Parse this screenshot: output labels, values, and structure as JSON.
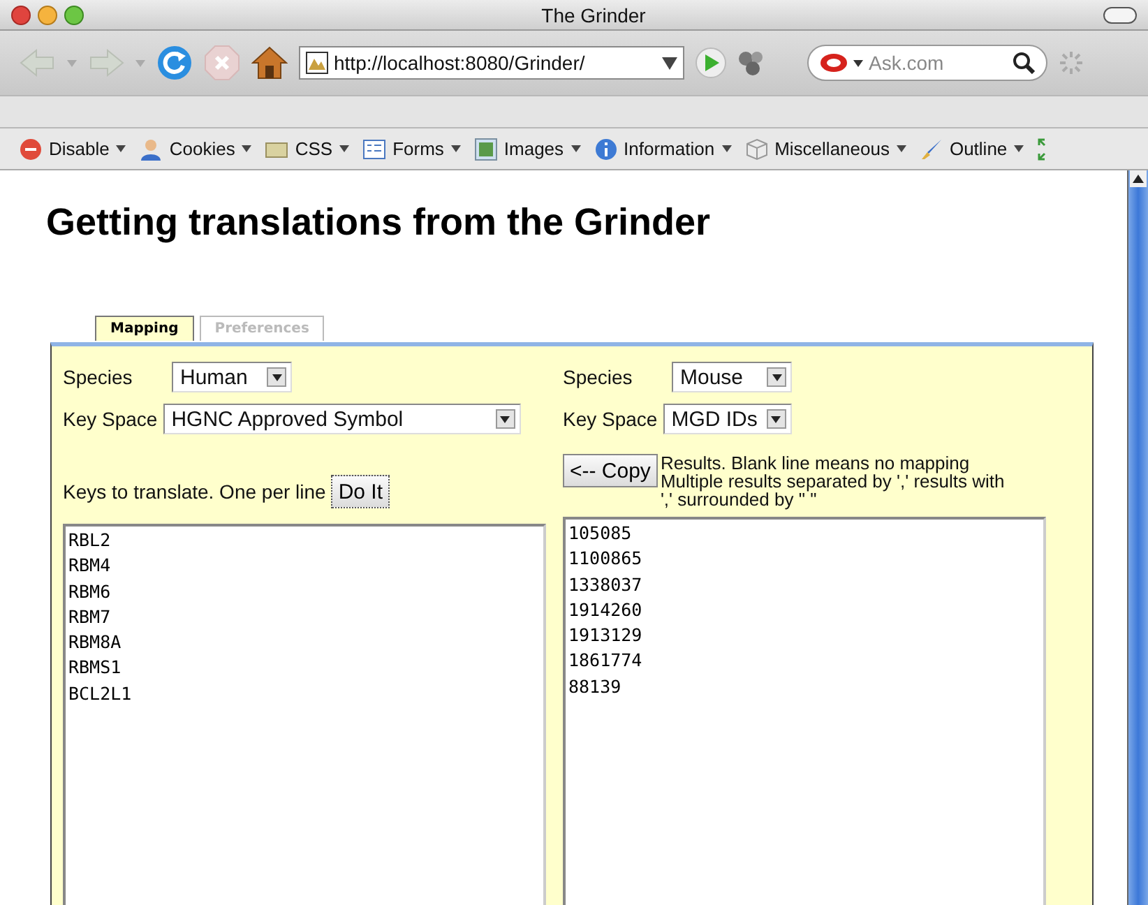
{
  "window": {
    "title": "The Grinder"
  },
  "navbar": {
    "url": "http://localhost:8080/Grinder/",
    "search_placeholder": "Ask.com"
  },
  "dev_toolbar": {
    "items": [
      {
        "label": "Disable"
      },
      {
        "label": "Cookies"
      },
      {
        "label": "CSS"
      },
      {
        "label": "Forms"
      },
      {
        "label": "Images"
      },
      {
        "label": "Information"
      },
      {
        "label": "Miscellaneous"
      },
      {
        "label": "Outline"
      }
    ]
  },
  "page": {
    "heading": "Getting translations from the Grinder",
    "tabs": [
      {
        "label": "Mapping",
        "selected": true
      },
      {
        "label": "Preferences",
        "selected": false
      }
    ],
    "source": {
      "species_label": "Species",
      "species": "Human",
      "key_space_label": "Key Space",
      "key_space": "HGNC Approved Symbol",
      "keys_label": "Keys to translate. One per line",
      "do_it": "Do It",
      "keys": [
        "RBL2",
        "RBM4",
        "RBM6",
        "RBM7",
        "RBM8A",
        "RBMS1",
        "BCL2L1"
      ]
    },
    "target": {
      "species_label": "Species",
      "species": "Mouse",
      "key_space_label": "Key Space",
      "key_space": "MGD IDs",
      "copy": "<-- Copy",
      "note": "Results. Blank line means no mapping Multiple results separated by ',' results with ',' surrounded by \" \"",
      "results": [
        "105085",
        "1100865",
        "1338037",
        "1914260",
        "1913129",
        "1861774",
        "88139"
      ]
    }
  }
}
